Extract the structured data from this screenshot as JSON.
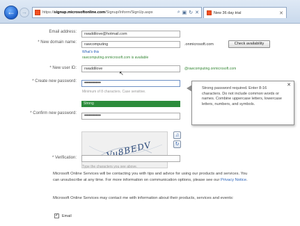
{
  "browser": {
    "url_prefix": "https://",
    "url_domain": "signup.microsoftonline.com",
    "url_path": "/Signup/Inform/SignUp.aspx",
    "addr_icons": [
      "search-icon",
      "lock-icon",
      "refresh-icon",
      "close-icon"
    ],
    "tab_title": "New 36 day trial"
  },
  "form": {
    "email_label": "Email address:",
    "email_value": "rwaddilove@hotmail.com",
    "domain_label": "* New domain name:",
    "domain_value": "rawcomputing",
    "domain_suffix": ".onmicrosoft.com",
    "check_button": "Check availability",
    "whats_this": "What's this",
    "domain_available": "rawcomputing.onmicrosoft.com is available",
    "userid_label": "* New user ID:",
    "userid_value": "rwaddilove",
    "userid_suffix": "@rawcomputing.onmicrosoft.com",
    "password_label": "* Create new password:",
    "password_value": "••••••••••••",
    "password_hint": "Minimum of 8 characters. Case sensitive.",
    "strength_label": "Strong",
    "confirm_label": "* Confirm new password:",
    "confirm_value": "••••••••••••",
    "verification_label": "* Verification:",
    "captcha_hint": "Type the characters you see above.",
    "captcha_text": "Vu8BEDV"
  },
  "tooltip": {
    "text": "Strong password required. Enter 8-16 characters. Do not include common words or names. Combine uppercase letters, lowercase letters, numbers, and symbols."
  },
  "contact": {
    "para1": "Microsoft Online Services will be contacting you with tips and advice for using our products and services. You can unsubscribe at any time. For more information on communication options, please see our ",
    "privacy_link": "Privacy Notice",
    "para2": "Microsoft Online Services may contact me with information about their products, services and events:",
    "email_option": "Email",
    "email_checked": "✓"
  }
}
